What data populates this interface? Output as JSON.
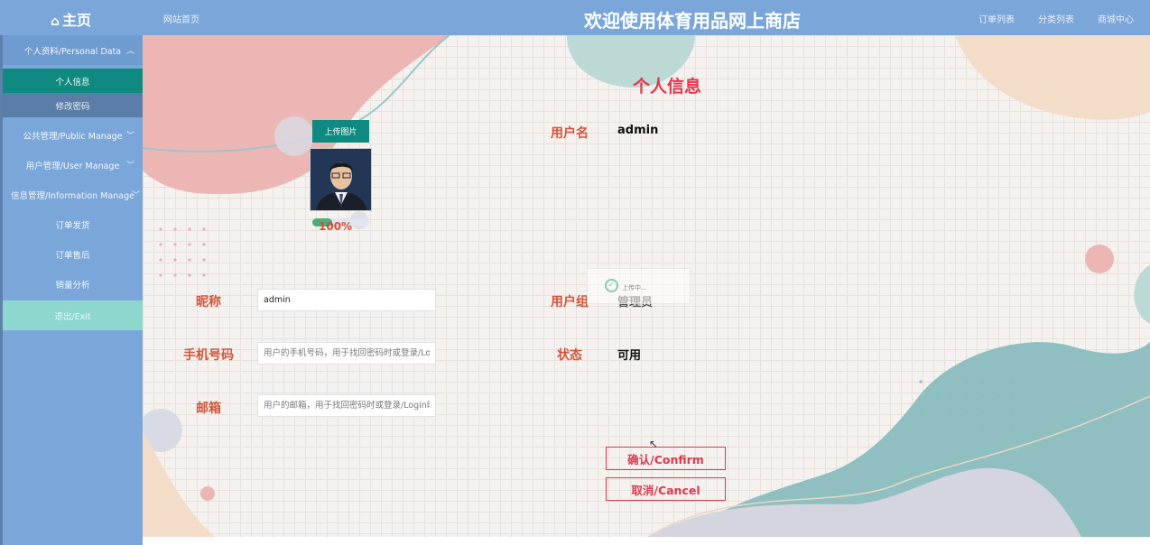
{
  "header": {
    "home_label": "主页",
    "site_link": "网站首页",
    "title": "欢迎使用体育用品网上商店",
    "nav": [
      "订单列表",
      "分类列表",
      "商城中心"
    ]
  },
  "sidebar": {
    "group": "个人资料/Personal Data",
    "sub_items": [
      "个人信息",
      "修改密码"
    ],
    "items": [
      "公共管理/Public Manage",
      "用户管理/User Manage",
      "信息管理/Information Manage",
      "订单发货",
      "订单售后",
      "销量分析"
    ],
    "exit": "退出/Exit"
  },
  "page": {
    "title": "个人信息",
    "upload_button": "上传图片",
    "upload_progress": 100,
    "upload_progress_text": "100%",
    "loading_text": "上传中..."
  },
  "form": {
    "username_label": "用户名",
    "username_value": "admin",
    "nickname_label": "昵称",
    "nickname_value": "admin",
    "group_label": "用户组",
    "group_value": "管理员",
    "phone_label": "手机号码",
    "phone_placeholder": "用户的手机号码，用于找回密码时或登录/Login",
    "status_label": "状态",
    "status_value": "可用",
    "email_label": "邮箱",
    "email_placeholder": "用户的邮箱，用于找回密码时或登录/Login时"
  },
  "actions": {
    "confirm": "确认/Confirm",
    "cancel": "取消/Cancel"
  },
  "colors": {
    "header_bg": "#7aa6d9",
    "active_item": "#0f8a80",
    "exit_bg": "#8ed7cf",
    "accent_red": "#e0384f",
    "label_orange": "#d2553b"
  }
}
